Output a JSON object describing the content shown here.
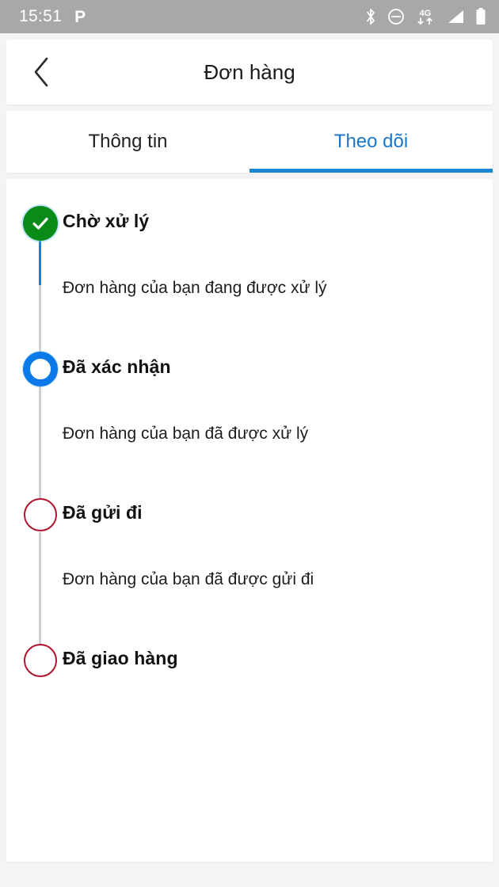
{
  "status_bar": {
    "time": "15:51",
    "p_icon_label": "P",
    "icons": [
      "bluetooth-icon",
      "do-not-disturb-icon",
      "mobile-data-4g-icon",
      "signal-icon",
      "battery-icon"
    ],
    "network_label": "4G",
    "background_color": "#a8a8a8"
  },
  "header": {
    "back_label": "‹",
    "title": "Đơn hàng"
  },
  "tabs": {
    "items": [
      {
        "label": "Thông tin",
        "active": false
      },
      {
        "label": "Theo dõi",
        "active": true
      }
    ],
    "active_color": "#1877c9",
    "inactive_color": "#212121",
    "indicator_color": "#1b87d2"
  },
  "tracking": {
    "steps": [
      {
        "title": "Chờ xử lý",
        "description": "Đơn hàng của bạn đang được xử lý",
        "state": "done",
        "marker_color": "#0a8a16",
        "icon": "check-icon",
        "line_color": "#1b7ed6"
      },
      {
        "title": "Đã xác nhận",
        "description": "Đơn hàng của bạn đã được xử lý",
        "state": "current",
        "marker_color": "#0b7ae8",
        "icon": "ring-icon",
        "line_color": "#cccccc"
      },
      {
        "title": "Đã gửi đi",
        "description": "Đơn hàng của bạn đã được gửi đi",
        "state": "pending",
        "marker_color": "#b0142e",
        "icon": "empty-circle-icon",
        "line_color": "#cccccc"
      },
      {
        "title": "Đã giao hàng",
        "description": "",
        "state": "pending",
        "marker_color": "#b0142e",
        "icon": "empty-circle-icon",
        "line_color": ""
      }
    ]
  }
}
